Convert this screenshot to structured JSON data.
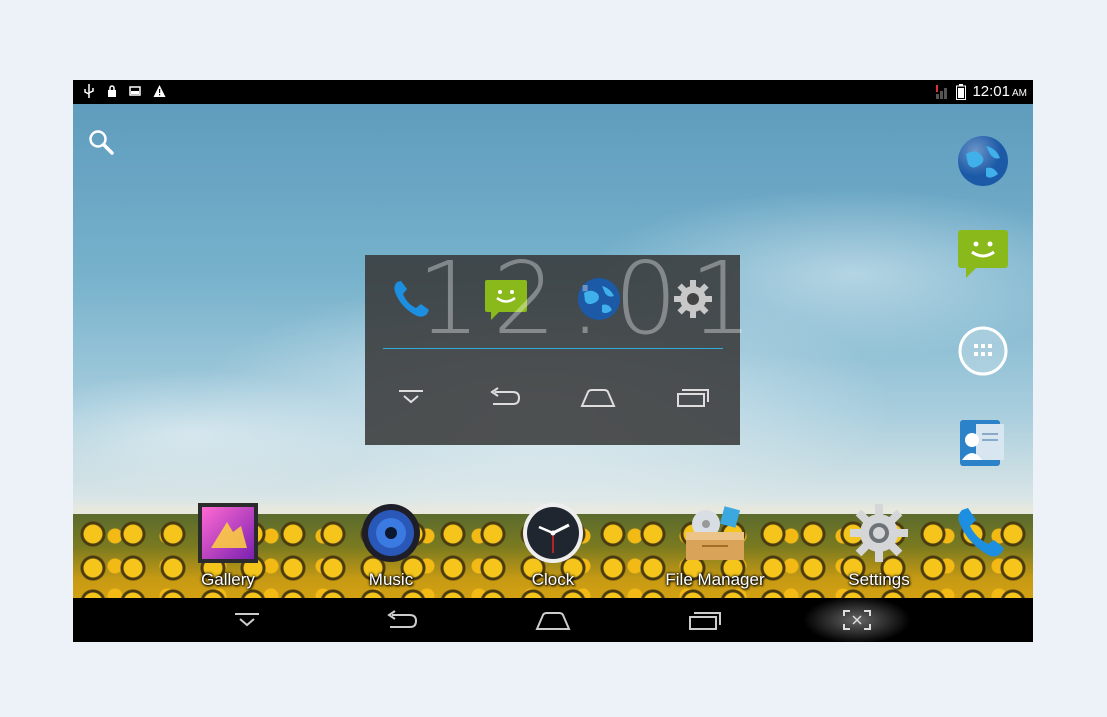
{
  "status_bar": {
    "time": "12:01",
    "ampm": "AM",
    "icons": [
      "usb-icon",
      "lock-icon",
      "image-icon",
      "warning-icon",
      "no-signal-icon",
      "battery-icon"
    ]
  },
  "home": {
    "search_icon": "search-icon",
    "right_dock": [
      "browser-icon",
      "messaging-icon",
      "all-apps-icon",
      "contacts-icon"
    ]
  },
  "quick_panel": {
    "clock_text": "12:01",
    "apps": [
      "phone-icon",
      "messaging-icon",
      "browser-icon",
      "settings-icon"
    ],
    "nav": [
      "hide-bar-icon",
      "back-icon",
      "home-icon",
      "recent-apps-icon"
    ]
  },
  "apps": [
    {
      "label": "Gallery",
      "icon": "gallery-icon"
    },
    {
      "label": "Music",
      "icon": "music-icon"
    },
    {
      "label": "Clock",
      "icon": "clock-icon"
    },
    {
      "label": "File Manager",
      "icon": "file-manager-icon"
    },
    {
      "label": "Settings",
      "icon": "settings-icon"
    },
    {
      "label": "",
      "icon": "phone-icon"
    }
  ],
  "nav_bar": [
    "hide-bar-icon",
    "back-icon",
    "home-icon",
    "recent-apps-icon",
    "screenshot-icon"
  ],
  "colors": {
    "accent": "#34aadc",
    "phone_blue": "#1d8fe0",
    "message_green": "#8ab91b"
  }
}
